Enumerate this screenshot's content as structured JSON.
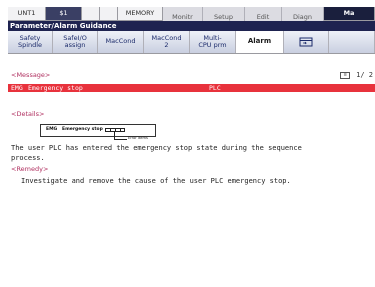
{
  "mode_bar": {
    "cells": [
      {
        "label": "UNT1",
        "style": "blank"
      },
      {
        "label": "$1",
        "style": "dark"
      },
      {
        "label": "",
        "style": "blank"
      },
      {
        "label": "",
        "style": "blank"
      },
      {
        "label": "MEMORY",
        "style": "blank"
      },
      {
        "label": "Monitr",
        "style": "tab"
      },
      {
        "label": "Setup",
        "style": "tab"
      },
      {
        "label": "Edit",
        "style": "tab"
      },
      {
        "label": "Diagn",
        "style": "tab"
      },
      {
        "label": "Ma",
        "style": "active"
      }
    ]
  },
  "title": "Parameter/Alarm Guidance",
  "tabs": [
    {
      "line1": "Safety",
      "line2": "Spindle"
    },
    {
      "line1": "SafeI/O",
      "line2": "assign"
    },
    {
      "line1": "MacCond",
      "line2": ""
    },
    {
      "line1": "MacCond",
      "line2": "2"
    },
    {
      "line1": "Multi-",
      "line2": "CPU prm"
    },
    {
      "line1": "Alarm",
      "line2": ""
    }
  ],
  "message_section": {
    "label": "<Message>",
    "page": "1/ 2",
    "alarm": {
      "code": "EMG",
      "text": "Emergency stop",
      "source": "PLC"
    }
  },
  "details_section": {
    "label": "<Details>",
    "diagram": {
      "code": "EMG",
      "text": "Emergency stop",
      "error_label": "Error items"
    },
    "description_line1": "The user PLC has entered the emergency stop state during the sequence",
    "description_line2": "process."
  },
  "remedy_section": {
    "label": "<Remedy>",
    "text": "Investigate and remove the cause of the user PLC emergency stop."
  },
  "colors": {
    "alarm_bar": "#e8323c",
    "title_bar": "#1e2350",
    "section_label": "#b03060"
  },
  "icons": {
    "tab_icon": "window-switch-icon",
    "pager_icon": "page-list-icon"
  }
}
